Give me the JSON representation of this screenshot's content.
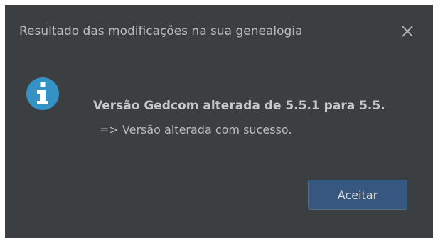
{
  "dialog": {
    "title": "Resultado das modificações na sua genealogia",
    "close_icon": "close-icon",
    "info_icon": "info-icon",
    "message": "Versão Gedcom alterada de 5.5.1 para 5.5.",
    "detail": "=> Versão alterada com sucesso.",
    "ok_label": "Aceitar"
  },
  "colors": {
    "background": "#3c3f41",
    "text": "#bbbbbb",
    "info_icon": "#3592c4",
    "button": "#365880"
  }
}
